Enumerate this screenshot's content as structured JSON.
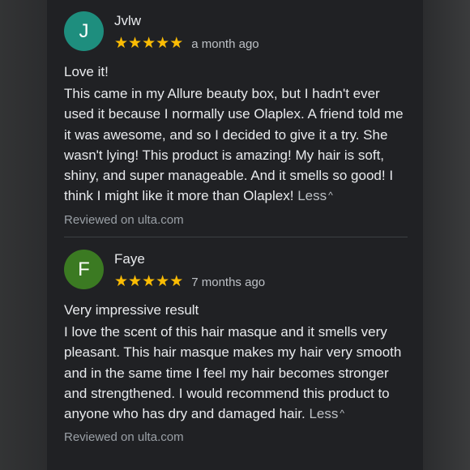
{
  "colors": {
    "avatar_j": "#1e8e7e",
    "avatar_f": "#3b7a22",
    "star": "#fbbc04"
  },
  "reviews": [
    {
      "avatar_letter": "J",
      "name": "Jvlw",
      "rating": 5,
      "time": "a month ago",
      "title": "Love it!",
      "body": "This came in my Allure beauty box, but I hadn't ever used it because I normally use Olaplex. A friend told me it was awesome, and so I decided to give it a try. She wasn't lying! This product is amazing! My hair is soft, shiny, and super manageable. And it smells so good! I think I might like it more than Olaplex!",
      "less_label": "Less",
      "source": "Reviewed on ulta.com"
    },
    {
      "avatar_letter": "F",
      "name": "Faye",
      "rating": 5,
      "time": "7 months ago",
      "title": "Very impressive result",
      "body": "I love the scent of this hair masque and it smells very pleasant. This hair masque makes my hair very smooth and in the same time I feel my hair becomes stronger and strengthened. I would recommend this product to anyone who has dry and damaged hair.",
      "less_label": "Less",
      "source": "Reviewed on ulta.com"
    }
  ]
}
